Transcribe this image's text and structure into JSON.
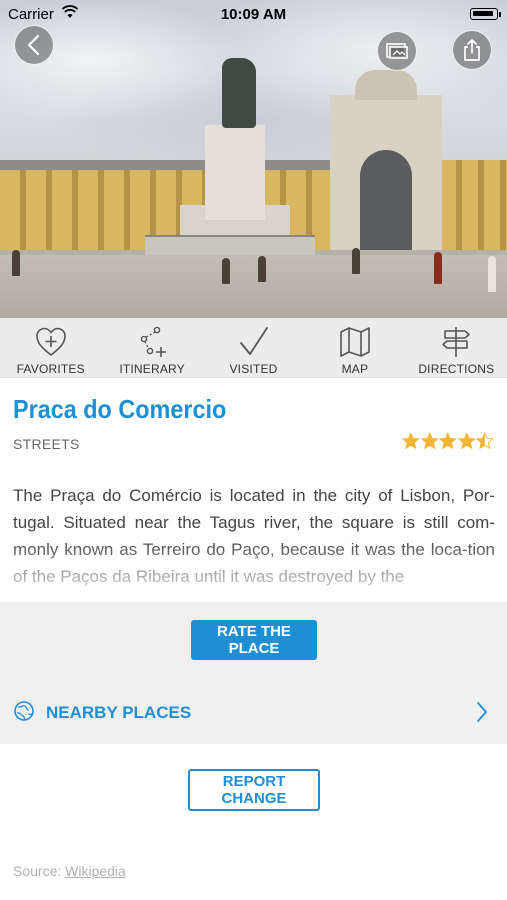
{
  "status_bar": {
    "carrier": "Carrier",
    "time": "10:09 AM"
  },
  "hero": {
    "back_icon": "chevron-left-icon",
    "gallery_icon": "gallery-icon",
    "share_icon": "share-icon"
  },
  "actions": [
    {
      "label": "FAVORITES",
      "icon": "heart-plus-icon"
    },
    {
      "label": "ITINERARY",
      "icon": "itinerary-icon"
    },
    {
      "label": "VISITED",
      "icon": "checkmark-icon"
    },
    {
      "label": "MAP",
      "icon": "map-icon"
    },
    {
      "label": "DIRECTIONS",
      "icon": "signpost-icon"
    }
  ],
  "place": {
    "title": "Praca do Comercio",
    "category": "STREETS",
    "rating": 4.5,
    "rating_max": 5,
    "description": "The Praça do Comércio is located in the city of Lisbon, Por-tugal. Situated near the Tagus river, the square is still com-monly known as Terreiro do Paço, because it was the loca-tion of the Paços da Ribeira until it was destroyed by the"
  },
  "buttons": {
    "rate": "RATE THE PLACE",
    "nearby": "NEARBY PLACES",
    "report": "REPORT CHANGE"
  },
  "source": {
    "prefix": "Source:",
    "link": "Wikipedia"
  },
  "colors": {
    "accent": "#1f8fd4",
    "star": "#f2b632"
  }
}
